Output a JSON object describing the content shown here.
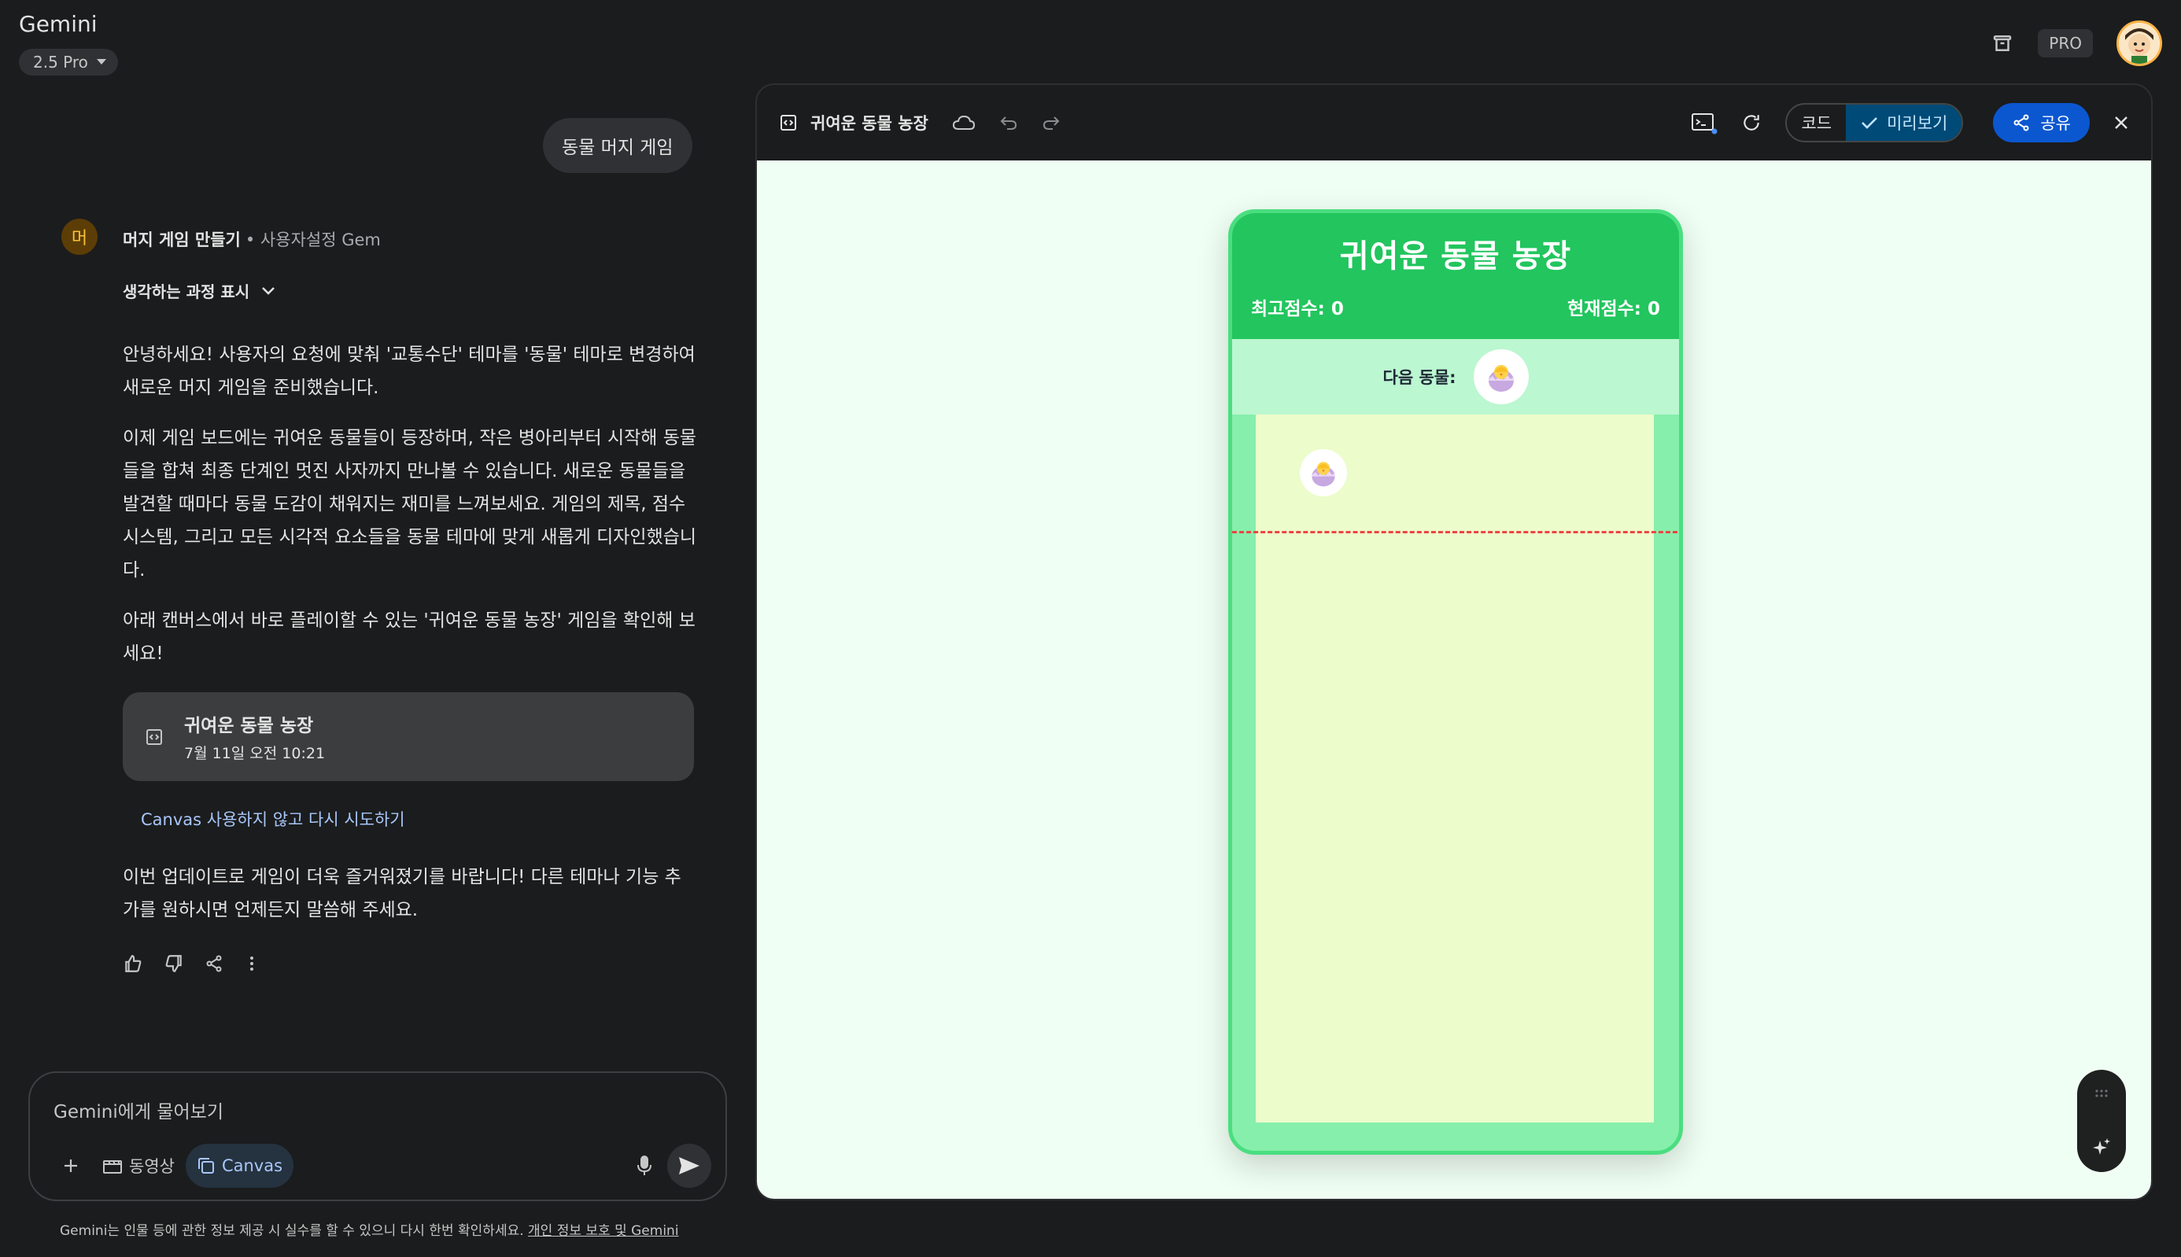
{
  "app": {
    "title": "Gemini",
    "model": "2.5 Pro",
    "badge": "PRO"
  },
  "chat": {
    "user_message": "동물 머지 게임",
    "gem": {
      "avatar_letter": "머",
      "name": "머지 게임 만들기",
      "type": "• 사용자설정 Gem"
    },
    "thinking_label": "생각하는 과정 표시",
    "paragraphs": [
      "안녕하세요! 사용자의 요청에 맞춰 '교통수단' 테마를 '동물' 테마로 변경하여 새로운 머지 게임을 준비했습니다.",
      "이제 게임 보드에는 귀여운 동물들이 등장하며, 작은 병아리부터 시작해 동물들을 합쳐 최종 단계인 멋진 사자까지 만나볼 수 있습니다. 새로운 동물들을 발견할 때마다 동물 도감이 채워지는 재미를 느껴보세요. 게임의 제목, 점수 시스템, 그리고 모든 시각적 요소들을 동물 테마에 맞게 새롭게 디자인했습니다.",
      "아래 캔버스에서 바로 플레이할 수 있는 '귀여운 동물 농장' 게임을 확인해 보세요!"
    ],
    "canvas_card": {
      "title": "귀여운 동물 농장",
      "date": "7월 11일 오전 10:21"
    },
    "retry_link": "Canvas 사용하지 않고 다시 시도하기",
    "closing": "이번 업데이트로 게임이 더욱 즐거워졌기를 바랍니다! 다른 테마나 기능 추가를 원하시면 언제든지 말씀해 주세요."
  },
  "input": {
    "placeholder": "Gemini에게 물어보기",
    "video_label": "동영상",
    "canvas_label": "Canvas"
  },
  "disclaimer": {
    "text": "Gemini는 인물 등에 관한 정보 제공 시 실수를 할 수 있으니 다시 한번 확인하세요. ",
    "link": "개인 정보 보호 및 Gemini"
  },
  "panel": {
    "title": "귀여운 동물 농장",
    "code_label": "코드",
    "preview_label": "미리보기",
    "share_label": "공유"
  },
  "game": {
    "title": "귀여운 동물 농장",
    "best_score": "최고점수: 0",
    "current_score": "현재점수: 0",
    "next_label": "다음 동물:",
    "next_animal_icon": "hatching-chick-icon",
    "drop_animal_icon": "hatching-chick-icon"
  },
  "colors": {
    "accent": "#0b57d0",
    "game_header": "#22c55e",
    "game_border": "#4ade80",
    "danger_line": "#ef4444",
    "link": "#a8c7fa"
  }
}
